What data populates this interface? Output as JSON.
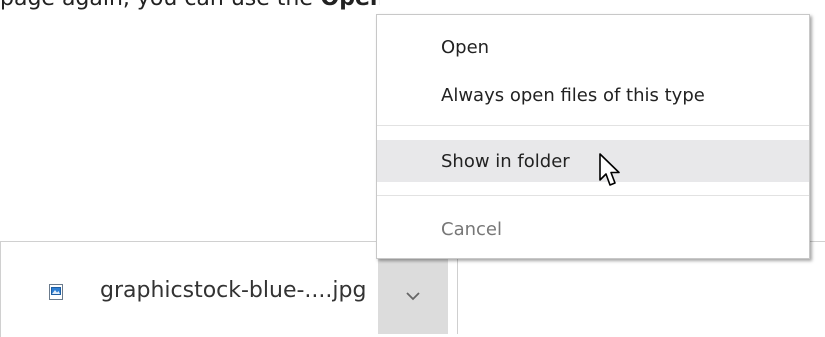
{
  "background_text": {
    "normal": "page again, you can use the",
    "bold": " Open"
  },
  "context_menu": {
    "items": [
      {
        "label": "Open"
      },
      {
        "label": "Always open files of this type"
      },
      {
        "label": "Show in folder"
      },
      {
        "label": "Cancel"
      }
    ]
  },
  "download_shelf": {
    "item": {
      "file_name": "graphicstock-blue-....jpg",
      "icon": "image-file-icon",
      "menu_icon": "chevron-down-icon"
    }
  },
  "colors": {
    "hover_bg": "#e8e8ea",
    "chevron_button_bg": "#dcdcdc",
    "disabled_text": "#777777"
  }
}
